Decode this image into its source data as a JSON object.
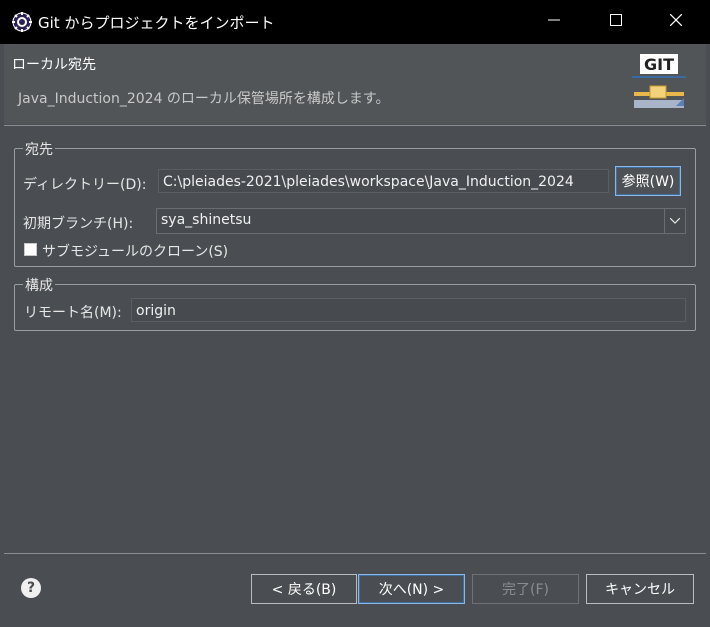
{
  "window": {
    "title": "Git からプロジェクトをインポート",
    "icon": "eclipse-icon",
    "controls": [
      "minimize-icon",
      "maximize-icon",
      "close-icon"
    ]
  },
  "header": {
    "title": "ローカル宛先",
    "description": "Java_Induction_2024 のローカル保管場所を構成します。",
    "logo_text": "GIT"
  },
  "destination": {
    "group_title": "宛先",
    "directory_label": "ディレクトリー(D):",
    "directory_value": "C:\\pleiades-2021\\pleiades\\workspace\\Java_Induction_2024",
    "browse_label": "参照(W)",
    "branch_label": "初期ブランチ(H):",
    "branch_value": "sya_shinetsu",
    "submodule_label": "サブモジュールのクローン(S)",
    "submodule_checked": false
  },
  "configuration": {
    "group_title": "構成",
    "remote_label": "リモート名(M):",
    "remote_value": "origin"
  },
  "footer": {
    "back_label": "< 戻る(B)",
    "next_label": "次へ(N) >",
    "finish_label": "完了(F)",
    "cancel_label": "キャンセル",
    "finish_enabled": false
  },
  "colors": {
    "background": "#4a4e52",
    "titlebar": "#000000",
    "focus_border": "#8bb6e6"
  }
}
